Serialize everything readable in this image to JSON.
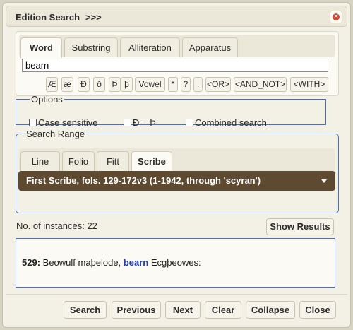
{
  "window": {
    "title": "Edition Search",
    "title_extra": ">>>",
    "close_glyph": "×"
  },
  "word_tabs": [
    "Word",
    "Substring",
    "Alliteration",
    "Apparatus"
  ],
  "search": {
    "value": "bearn"
  },
  "char_buttons": [
    "Æ",
    "æ",
    "Ð",
    "ð",
    "Þ",
    "þ",
    "Vowel",
    "*",
    "?",
    ".",
    "<OR>",
    "<AND_NOT>",
    "<WITH>"
  ],
  "options": {
    "legend": "Options",
    "items": [
      "Case sensitive",
      "Ð = Þ",
      "Combined search"
    ]
  },
  "range": {
    "legend": "Search Range",
    "tabs": [
      "Line",
      "Folio",
      "Fitt",
      "Scribe"
    ],
    "selected": "First Scribe, fols. 129-172v3 (1-1942, through 'scyran')"
  },
  "instances_text": "No. of instances: 22",
  "show_results_label": "Show Results",
  "result": {
    "line_number": "529:",
    "before": " Beowulf maþelode, ",
    "hit": "bearn",
    "after": " Ecgþeowes:"
  },
  "footer_buttons": [
    "Search",
    "Previous",
    "Next",
    "Clear",
    "Collapse",
    "Close"
  ],
  "colors": {
    "accent_border": "#4a6fc1",
    "select_bg": "#5d4a31",
    "hit_text": "#1d3fb0",
    "close_icon": "#d7452c"
  }
}
